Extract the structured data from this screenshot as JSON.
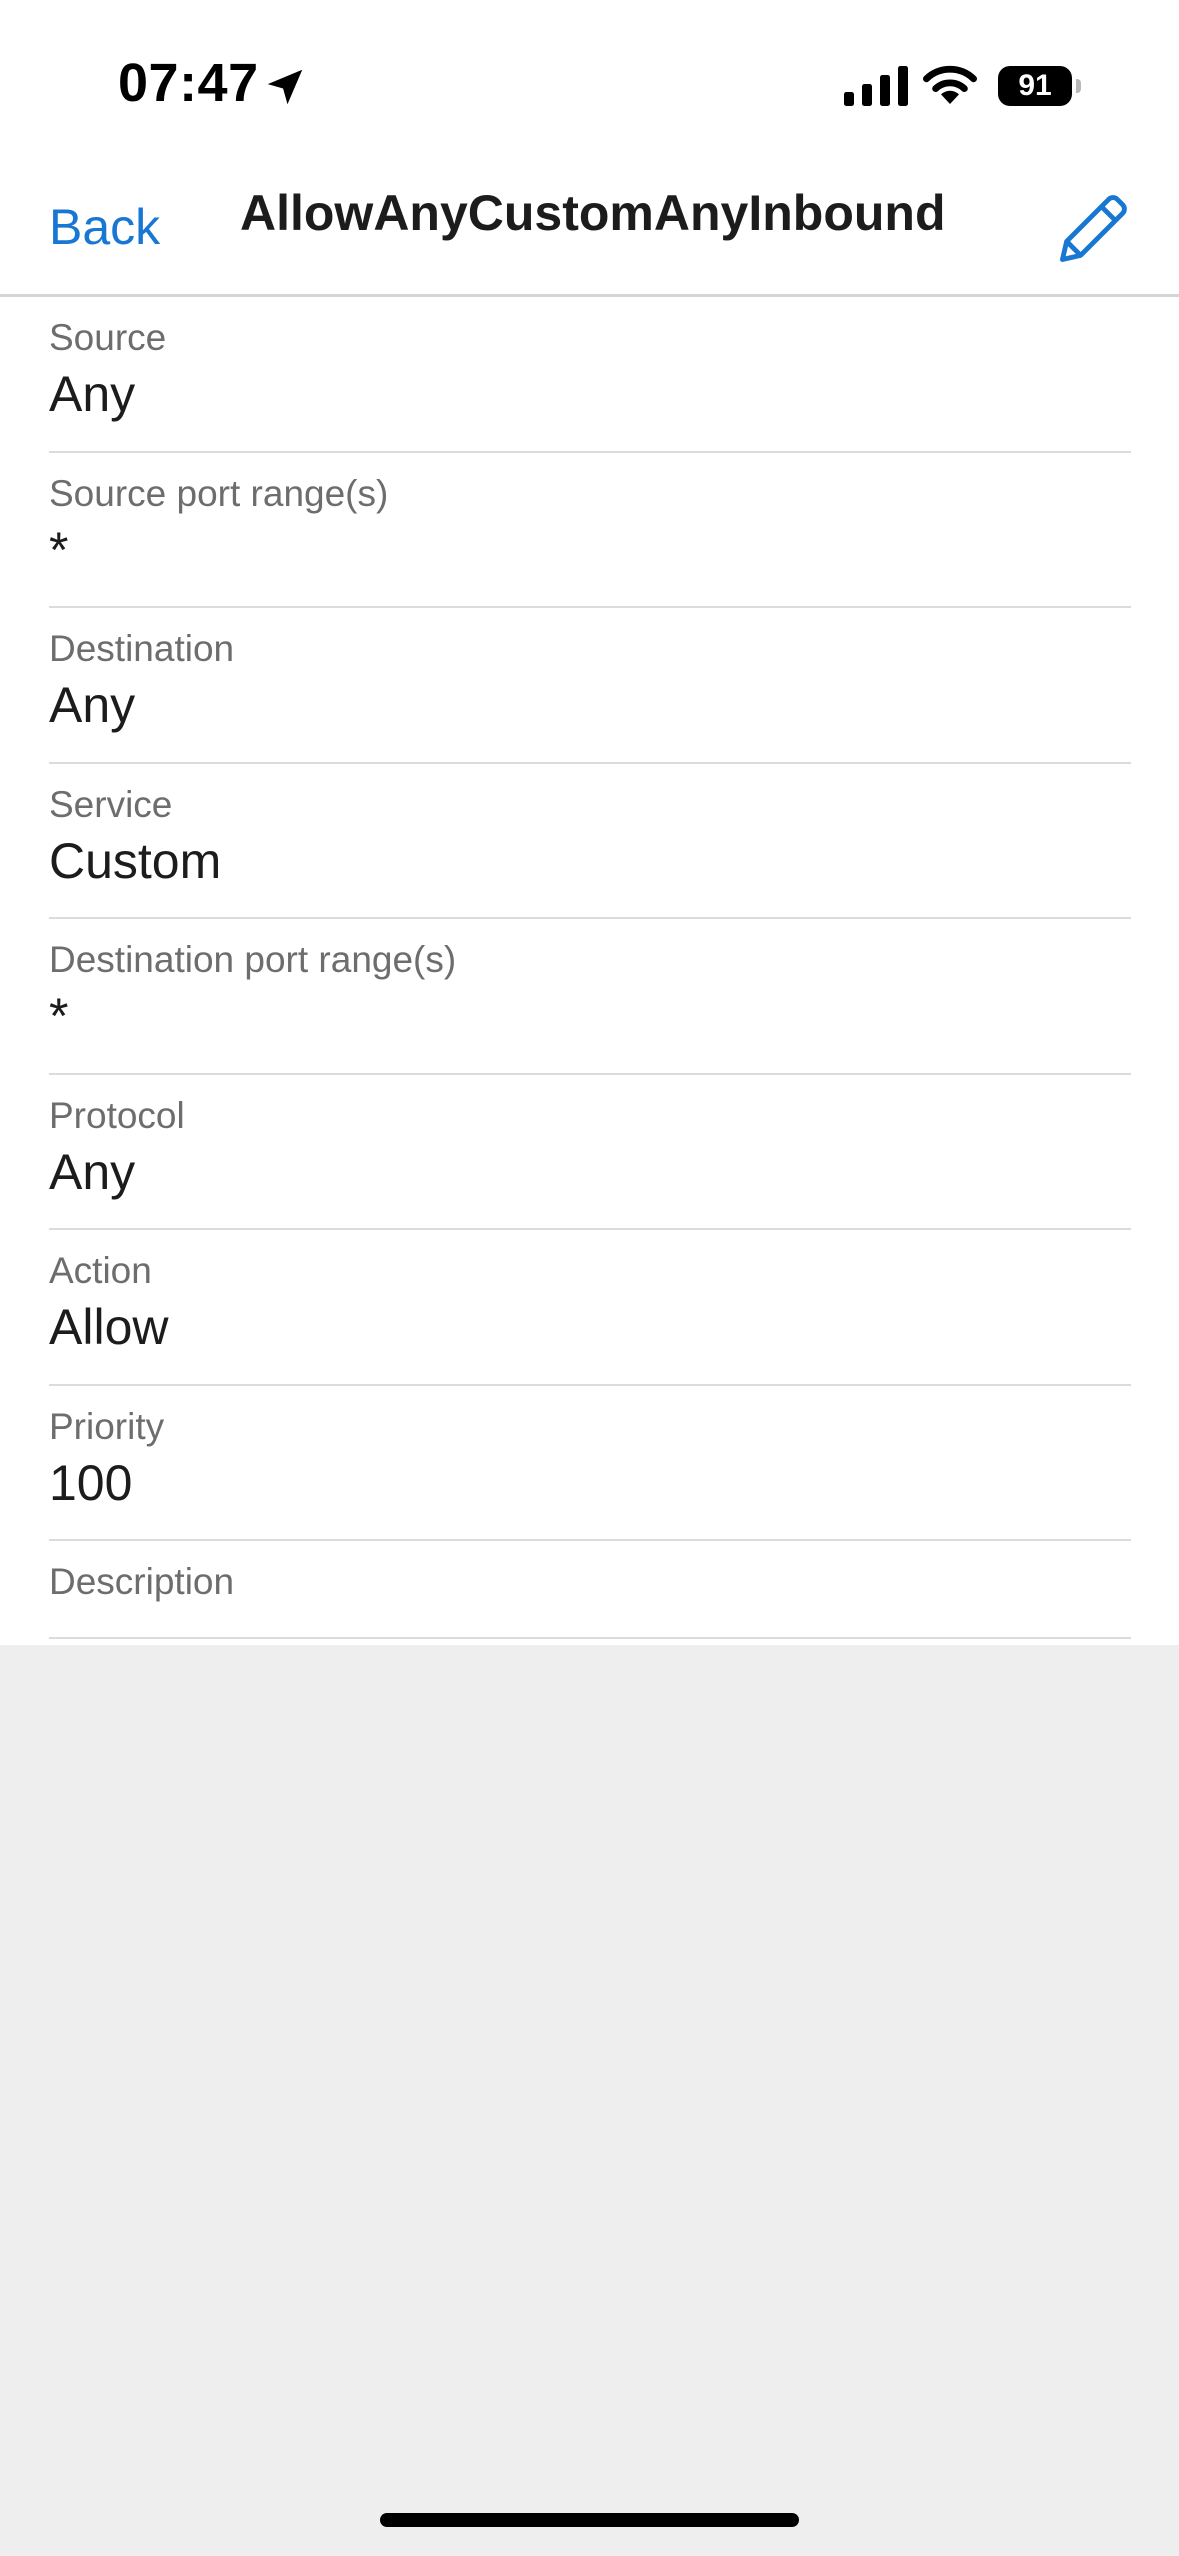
{
  "status_bar": {
    "time": "07:47",
    "battery_level": "91",
    "icons": [
      "location-arrow-icon",
      "cellular-signal-icon",
      "wifi-icon",
      "battery-icon"
    ]
  },
  "nav": {
    "back_label": "Back",
    "title": "AllowAnyCustomAnyInbound",
    "edit_icon": "pencil-icon"
  },
  "colors": {
    "accent": "#1877d2",
    "label": "#6d6d6d",
    "value": "#1c1c1c",
    "divider": "#dcdcdc",
    "background": "#eeeeee"
  },
  "fields": [
    {
      "label": "Source",
      "value": "Any"
    },
    {
      "label": "Source port range(s)",
      "value": "*"
    },
    {
      "label": "Destination",
      "value": "Any"
    },
    {
      "label": "Service",
      "value": "Custom"
    },
    {
      "label": "Destination port range(s)",
      "value": "*"
    },
    {
      "label": "Protocol",
      "value": "Any"
    },
    {
      "label": "Action",
      "value": "Allow"
    },
    {
      "label": "Priority",
      "value": "100"
    },
    {
      "label": "Description",
      "value": ""
    }
  ]
}
